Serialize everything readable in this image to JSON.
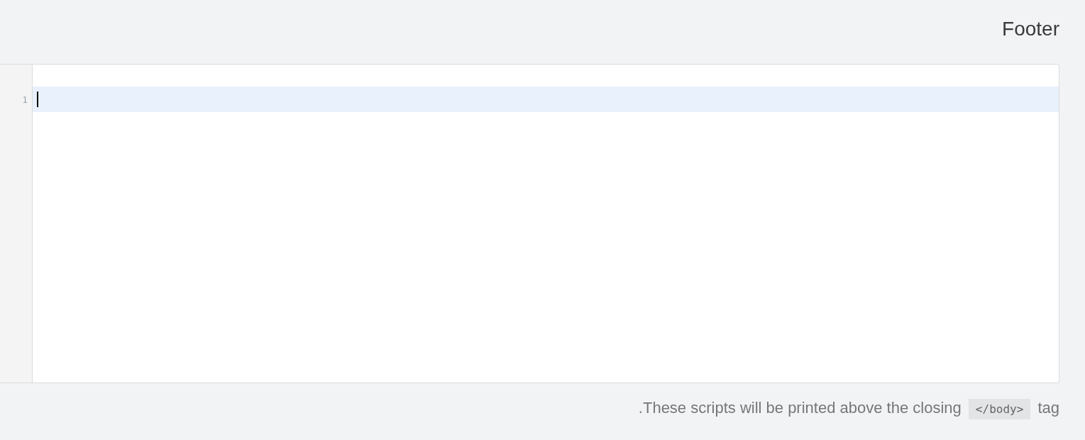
{
  "section": {
    "title": "Footer"
  },
  "editor": {
    "focused": true,
    "lines": [
      {
        "number": "1",
        "active": true
      }
    ]
  },
  "help_text": {
    "before": ".These scripts will be printed above the closing",
    "code": "</body>",
    "after": "tag"
  }
}
